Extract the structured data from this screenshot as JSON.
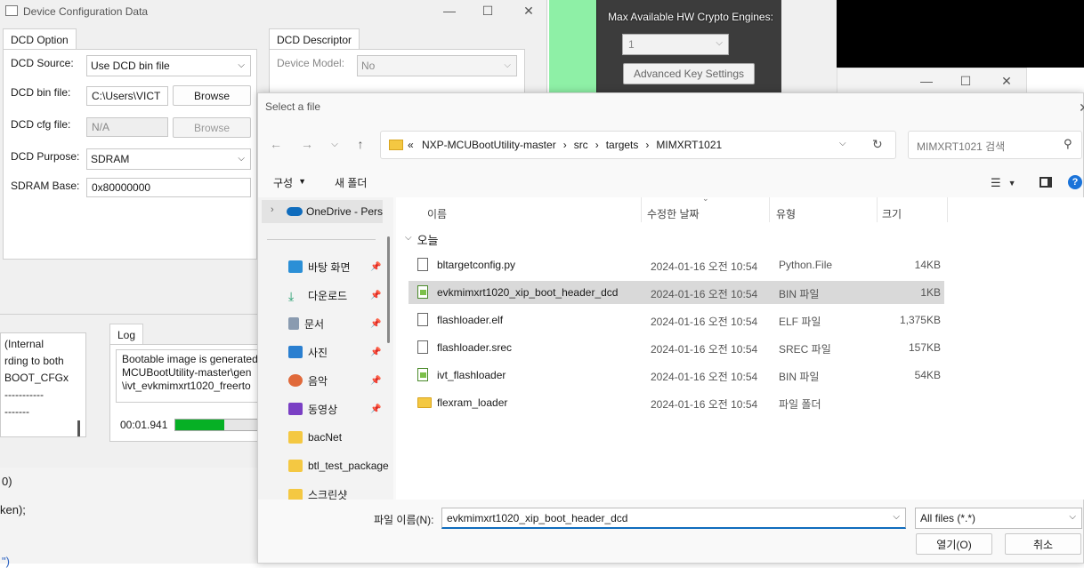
{
  "background": {
    "crypto_label": "Max Available HW Crypto Engines:",
    "crypto_value": "1",
    "advanced_key_button": "Advanced Key Settings"
  },
  "dcd_window": {
    "title": "Device Configuration Data",
    "option_tab": "DCD Option",
    "descriptor_tab": "DCD Descriptor",
    "source_label": "DCD Source:",
    "source_value": "Use DCD bin file",
    "bin_file_label": "DCD bin file:",
    "bin_file_value": "C:\\Users\\VICT",
    "browse_label": "Browse",
    "cfg_file_label": "DCD cfg file:",
    "cfg_file_value": "N/A",
    "browse_disabled_label": "Browse",
    "purpose_label": "DCD Purpose:",
    "purpose_value": "SDRAM",
    "sdram_base_label": "SDRAM Base:",
    "sdram_base_value": "0x80000000",
    "device_model_label": "Device Model:",
    "device_model_value": "No"
  },
  "main_app": {
    "left_text": [
      "(Internal",
      "rding to both",
      "BOOT_CFGx",
      "-----------",
      "-------"
    ],
    "log_tab": "Log",
    "log_text": [
      "Bootable image is generated",
      "MCUBootUtility-master\\gen",
      "\\ivt_evkmimxrt1020_freerto"
    ],
    "timer": "00:01.941",
    "progress_fraction": 0.6,
    "code_lines": [
      " 0)",
      "ken);",
      "",
      "\")"
    ]
  },
  "file_dialog": {
    "title": "Select a file",
    "breadcrumb": [
      "NXP-MCUBootUtility-master",
      "src",
      "targets",
      "MIMXRT1021"
    ],
    "search_placeholder": "MIMXRT1021 검색",
    "organize_label": "구성",
    "new_folder_label": "새 폴더",
    "nav_items": [
      {
        "label": "OneDrive - Pers",
        "icon": "onedrive-icon"
      },
      {
        "label": "바탕 화면",
        "icon": "desktop-icon"
      },
      {
        "label": "다운로드",
        "icon": "download-icon"
      },
      {
        "label": "문서",
        "icon": "documents-icon"
      },
      {
        "label": "사진",
        "icon": "pictures-icon"
      },
      {
        "label": "음악",
        "icon": "music-icon"
      },
      {
        "label": "동영상",
        "icon": "videos-icon"
      },
      {
        "label": "bacNet",
        "icon": "folder-icon"
      },
      {
        "label": "btl_test_package",
        "icon": "folder-icon"
      },
      {
        "label": "스크린샷",
        "icon": "folder-icon"
      }
    ],
    "columns": {
      "name": "이름",
      "date": "수정한 날짜",
      "type": "유형",
      "size": "크기"
    },
    "group_label": "오늘",
    "files": [
      {
        "name": "bltargetconfig.py",
        "date": "2024-01-16 오전 10:54",
        "type": "Python.File",
        "size": "14KB",
        "icon": "file-icon"
      },
      {
        "name": "evkmimxrt1020_xip_boot_header_dcd",
        "date": "2024-01-16 오전 10:54",
        "type": "BIN 파일",
        "size": "1KB",
        "icon": "bin-file-icon"
      },
      {
        "name": "flashloader.elf",
        "date": "2024-01-16 오전 10:54",
        "type": "ELF 파일",
        "size": "1,375KB",
        "icon": "file-icon"
      },
      {
        "name": "flashloader.srec",
        "date": "2024-01-16 오전 10:54",
        "type": "SREC 파일",
        "size": "157KB",
        "icon": "file-icon"
      },
      {
        "name": "ivt_flashloader",
        "date": "2024-01-16 오전 10:54",
        "type": "BIN 파일",
        "size": "54KB",
        "icon": "bin-file-icon"
      },
      {
        "name": "flexram_loader",
        "date": "2024-01-16 오전 10:54",
        "type": "파일 폴더",
        "size": "",
        "icon": "folder-icon"
      }
    ],
    "filename_label": "파일 이름(N):",
    "filename_value": "evkmimxrt1020_xip_boot_header_dcd",
    "filetype_value": "All files (*.*)",
    "open_label": "열기(O)",
    "cancel_label": "취소"
  }
}
